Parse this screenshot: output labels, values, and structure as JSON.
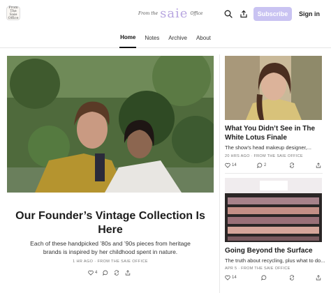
{
  "header": {
    "logo_text": "From The Saie Office",
    "wordmark_small_left": "From the",
    "wordmark_big": "saie",
    "wordmark_small_right": "Office",
    "subscribe_label": "Subscribe",
    "signin_label": "Sign in",
    "icons": [
      "search-icon",
      "share-icon"
    ],
    "accent_color": "#c9c3f2"
  },
  "nav": {
    "tabs": [
      "Home",
      "Notes",
      "Archive",
      "About"
    ],
    "active": "Home"
  },
  "featured": {
    "title": "Our Founder’s Vintage Collection Is Here",
    "subtitle": "Each of these handpicked ’80s and ’90s pieces from heritage brands is inspired by her childhood spent in nature.",
    "meta": "1 HR AGO · FROM THE SAIE OFFICE",
    "likes": "4"
  },
  "cards": [
    {
      "title": "What You Didn’t See in The White Lotus Finale",
      "subtitle": "The show's head makeup designer,...",
      "meta": "20 HRS AGO · FROM THE SAIE OFFICE",
      "likes": "14",
      "comments": "2"
    },
    {
      "title": "Going Beyond the Surface",
      "subtitle": "The truth about recycling, plus what to do...",
      "meta": "APR 5 · FROM THE SAIE OFFICE",
      "likes": "14",
      "comments": ""
    }
  ]
}
